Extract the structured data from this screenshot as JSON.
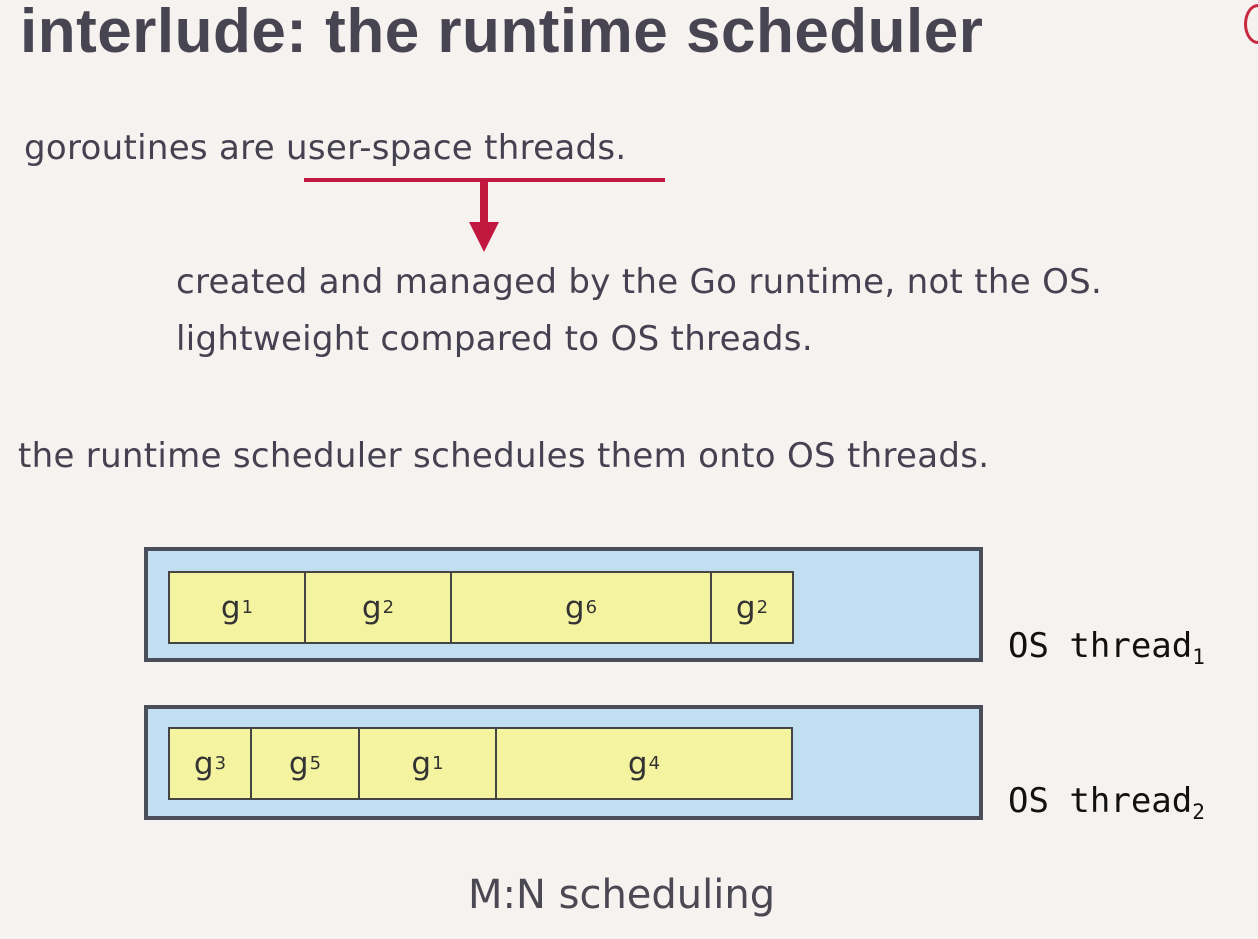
{
  "title": "interlude: the runtime scheduler",
  "intro": {
    "prefix": "goroutines are ",
    "emphasis": "user-space threads."
  },
  "details": [
    "created and managed by the Go runtime, not the OS.",
    "lightweight compared to OS threads."
  ],
  "scheduler_text": "the runtime scheduler schedules them onto OS threads.",
  "threads": [
    {
      "label": "OS thread",
      "label_sub": "1",
      "goroutines": [
        {
          "name": "g",
          "sub": "1"
        },
        {
          "name": "g",
          "sub": "2"
        },
        {
          "name": "g",
          "sub": "6"
        },
        {
          "name": "g",
          "sub": "2"
        }
      ]
    },
    {
      "label": "OS thread",
      "label_sub": "2",
      "goroutines": [
        {
          "name": "g",
          "sub": "3"
        },
        {
          "name": "g",
          "sub": "5"
        },
        {
          "name": "g",
          "sub": "1"
        },
        {
          "name": "g",
          "sub": "4"
        }
      ]
    }
  ],
  "caption": "M:N scheduling",
  "colors": {
    "accent": "#c2183f",
    "thread_fill": "#c2dff2",
    "goroutine_fill": "#f4f4a0",
    "background": "#f5f2ef"
  }
}
